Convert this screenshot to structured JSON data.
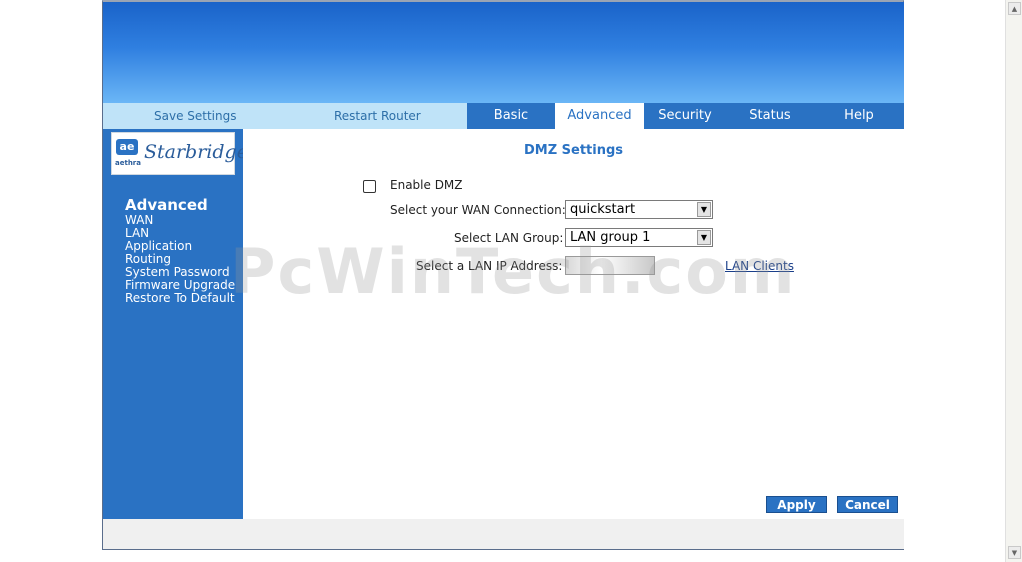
{
  "nav": {
    "save_settings": "Save Settings",
    "restart_router": "Restart Router",
    "tabs": [
      "Basic",
      "Advanced",
      "Security",
      "Status",
      "Help"
    ],
    "active_tab": "Advanced"
  },
  "logo": {
    "mark": "ae",
    "sub": "aethra",
    "brand": "Starbridge"
  },
  "sidebar": {
    "title": "Advanced",
    "items": [
      "WAN",
      "LAN",
      "Application",
      "Routing",
      "System Password",
      "Firmware Upgrade",
      "Restore To Default"
    ]
  },
  "main": {
    "title": "DMZ Settings",
    "enable_dmz_label": "Enable DMZ",
    "enable_dmz_checked": false,
    "wan_label": "Select your WAN Connection:",
    "wan_value": "quickstart",
    "lan_group_label": "Select LAN Group:",
    "lan_group_value": "LAN group 1",
    "lan_ip_label": "Select a LAN IP Address:",
    "lan_clients_link": "LAN Clients"
  },
  "buttons": {
    "apply": "Apply",
    "cancel": "Cancel"
  },
  "watermark": "PcWinTech.com",
  "colors": {
    "accent": "#2a72c3",
    "nav_light": "#bfe3f8",
    "title": "#2a72c3"
  }
}
